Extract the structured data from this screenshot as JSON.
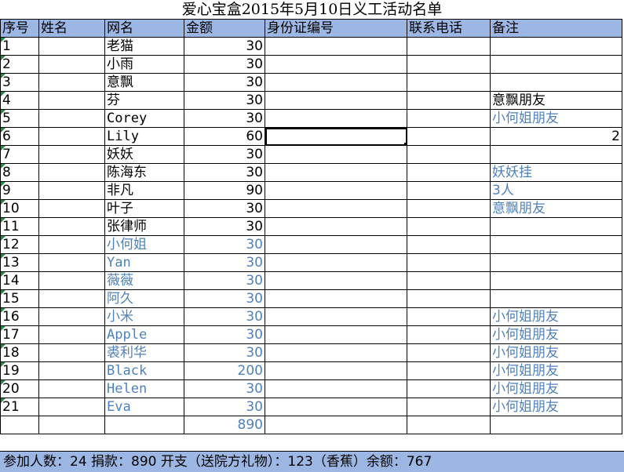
{
  "title": "爱心宝盒2015年5月10日义工活动名单",
  "columns": [
    "序号",
    "姓名",
    "网名",
    "金额",
    "身份证编号",
    "联系电话",
    "备注"
  ],
  "rows": [
    {
      "no": "1",
      "name": "",
      "nick": "老猫",
      "amount": "30",
      "id": "",
      "phone": "",
      "note": "",
      "blue": false,
      "note_blue": false
    },
    {
      "no": "2",
      "name": "",
      "nick": "小雨",
      "amount": "30",
      "id": "",
      "phone": "",
      "note": "",
      "blue": false,
      "note_blue": false
    },
    {
      "no": "3",
      "name": "",
      "nick": "意飘",
      "amount": "30",
      "id": "",
      "phone": "",
      "note": "",
      "blue": false,
      "note_blue": false
    },
    {
      "no": "4",
      "name": "",
      "nick": "芬",
      "amount": "30",
      "id": "",
      "phone": "",
      "note": "意飘朋友",
      "blue": false,
      "note_blue": false
    },
    {
      "no": "5",
      "name": "",
      "nick": "Corey",
      "amount": "30",
      "id": "",
      "phone": "",
      "note": "小何姐朋友",
      "blue": false,
      "note_blue": true
    },
    {
      "no": "6",
      "name": "",
      "nick": "Lily",
      "amount": "60",
      "id": "",
      "phone": "",
      "note": "2",
      "blue": false,
      "note_blue": false
    },
    {
      "no": "7",
      "name": "",
      "nick": "妖妖",
      "amount": "30",
      "id": "",
      "phone": "",
      "note": "",
      "blue": false,
      "note_blue": false
    },
    {
      "no": "8",
      "name": "",
      "nick": "陈海东",
      "amount": "30",
      "id": "",
      "phone": "",
      "note": "妖妖挂",
      "blue": false,
      "note_blue": true
    },
    {
      "no": "9",
      "name": "",
      "nick": "非凡",
      "amount": "90",
      "id": "",
      "phone": "",
      "note": "3人",
      "blue": false,
      "note_blue": true
    },
    {
      "no": "10",
      "name": "",
      "nick": "叶子",
      "amount": "30",
      "id": "",
      "phone": "",
      "note": "意飘朋友",
      "blue": false,
      "note_blue": true
    },
    {
      "no": "11",
      "name": "",
      "nick": "张律师",
      "amount": "30",
      "id": "",
      "phone": "",
      "note": "",
      "blue": false,
      "note_blue": false
    },
    {
      "no": "12",
      "name": "",
      "nick": "小何姐",
      "amount": "30",
      "id": "",
      "phone": "",
      "note": "",
      "blue": true,
      "note_blue": false
    },
    {
      "no": "13",
      "name": "",
      "nick": "Yan",
      "amount": "30",
      "id": "",
      "phone": "",
      "note": "",
      "blue": true,
      "note_blue": false
    },
    {
      "no": "14",
      "name": "",
      "nick": "薇薇",
      "amount": "30",
      "id": "",
      "phone": "",
      "note": "",
      "blue": true,
      "note_blue": false
    },
    {
      "no": "15",
      "name": "",
      "nick": "阿久",
      "amount": "30",
      "id": "",
      "phone": "",
      "note": "",
      "blue": true,
      "note_blue": false
    },
    {
      "no": "16",
      "name": "",
      "nick": "小米",
      "amount": "30",
      "id": "",
      "phone": "",
      "note": "小何姐朋友",
      "blue": true,
      "note_blue": true
    },
    {
      "no": "17",
      "name": "",
      "nick": "Apple",
      "amount": "30",
      "id": "",
      "phone": "",
      "note": "小何姐朋友",
      "blue": true,
      "note_blue": true
    },
    {
      "no": "18",
      "name": "",
      "nick": "裘利华",
      "amount": "30",
      "id": "",
      "phone": "",
      "note": "小何姐朋友",
      "blue": true,
      "note_blue": true
    },
    {
      "no": "19",
      "name": "",
      "nick": "Black",
      "amount": "200",
      "id": "",
      "phone": "",
      "note": "小何姐朋友",
      "blue": true,
      "note_blue": true
    },
    {
      "no": "20",
      "name": "",
      "nick": "Helen",
      "amount": "30",
      "id": "",
      "phone": "",
      "note": "小何姐朋友",
      "blue": true,
      "note_blue": true
    },
    {
      "no": "21",
      "name": "",
      "nick": "Eva",
      "amount": "30",
      "id": "",
      "phone": "",
      "note": "小何姐朋友",
      "blue": true,
      "note_blue": true
    }
  ],
  "total_amount": "890",
  "footer": "参加人数：24    捐款：890    开支（送院方礼物）：123（香蕉）余额：767",
  "colors": {
    "header_bg": "#9db7e4",
    "accent_text": "#4f81bd",
    "corner_marker": "#1f8a3a"
  }
}
